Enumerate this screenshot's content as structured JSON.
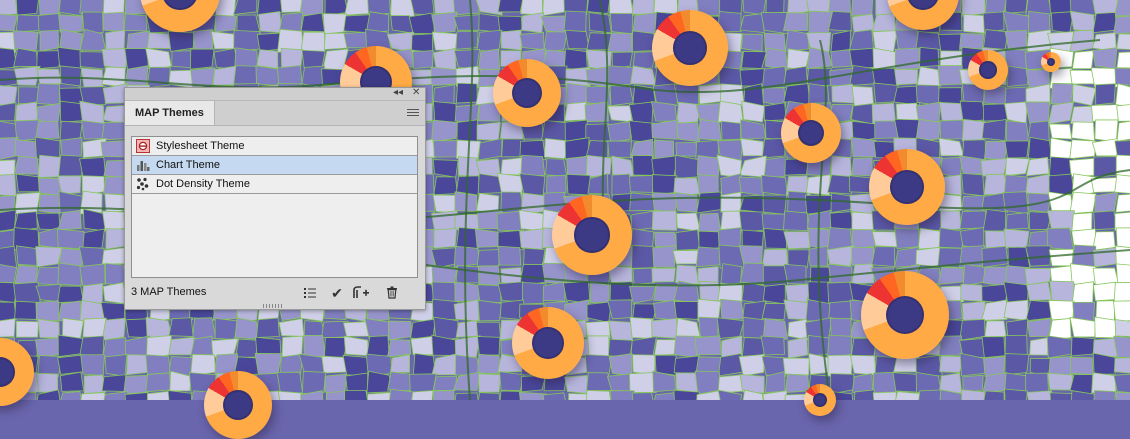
{
  "panel": {
    "tab_label": "MAP Themes",
    "collapse_glyph": "◂◂",
    "close_glyph": "✕",
    "themes": [
      {
        "label": "Stylesheet Theme",
        "icon": "stylesheet-icon",
        "selected": false
      },
      {
        "label": "Chart Theme",
        "icon": "chart-icon",
        "selected": true
      },
      {
        "label": "Dot Density Theme",
        "icon": "dot-density-icon",
        "selected": false
      }
    ],
    "count_label": "3 MAP Themes",
    "footer_icons": [
      "list-icon",
      "apply-check-icon",
      "add-theme-icon",
      "trash-icon"
    ]
  },
  "colors": {
    "map_base": "#6a66ae",
    "county_dark": "#4a479a",
    "county_light": "#b7b5dc",
    "boundary": "#86c65c",
    "donut_palette": [
      "#ffaa44",
      "#ffcc99",
      "#ee3333",
      "#ff6622",
      "#f28a2e"
    ],
    "selection": "#c5d9f0"
  }
}
